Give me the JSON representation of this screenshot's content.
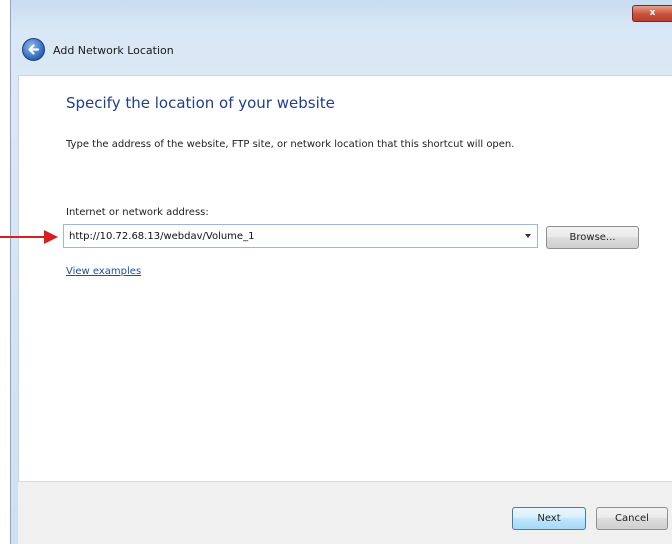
{
  "window": {
    "title": "Add Network Location",
    "close_label": "x"
  },
  "page": {
    "heading": "Specify the location of your website",
    "instructions": "Type the address of the website, FTP site, or network location that this shortcut will open."
  },
  "address": {
    "label": "Internet or network address:",
    "value": "http://10.72.68.13/webdav/Volume_1"
  },
  "buttons": {
    "browse": "Browse...",
    "next": "Next",
    "cancel": "Cancel"
  },
  "links": {
    "view_examples": "View examples"
  },
  "icons": {
    "back": "back-arrow-icon",
    "dropdown": "chevron-down-icon",
    "annotation": "red-arrow-icon"
  },
  "colors": {
    "heading": "#1f3f8f",
    "link": "#1e4ea8",
    "annotation_arrow": "#d81e1e",
    "close_button": "#c9503a"
  }
}
